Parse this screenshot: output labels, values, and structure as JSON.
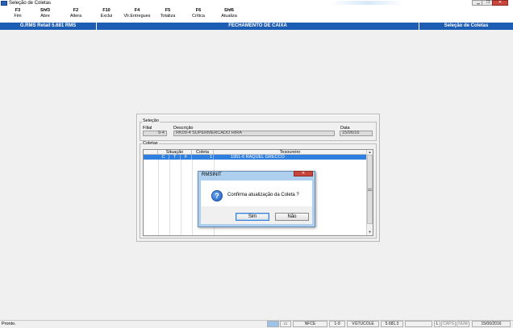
{
  "window": {
    "title": "Seleção de Coletas",
    "controls": {
      "minimize": "▁",
      "maximize": "❐",
      "close": "✕"
    }
  },
  "toolbar": [
    {
      "key": "F3",
      "label": "Fim"
    },
    {
      "key": "Shf3",
      "label": "Abre"
    },
    {
      "key": "F2",
      "label": "Altera"
    },
    {
      "key": "F10",
      "label": "Exclui"
    },
    {
      "key": "F4",
      "label": "Vlr.Entregues"
    },
    {
      "key": "F5",
      "label": "Totaliza"
    },
    {
      "key": "F6",
      "label": "Crítica"
    },
    {
      "key": "Shf6",
      "label": "Atualiza"
    }
  ],
  "header": {
    "system": "G.RMS Retail 5.681 RMS",
    "title": "FECHAMENTO DE CAIXA",
    "screen": "Seleção de Coletas",
    "color": "#1d5db3"
  },
  "selecao": {
    "group_label": "Seleção",
    "filial_label": "Filial",
    "filial_value": "9-4",
    "descricao_label": "Descrição",
    "descricao_value": "RK09-4 SUPERMERCADO HIRA",
    "data_label": "Data",
    "data_value": "15/06/16"
  },
  "coletas": {
    "group_label": "Coletas",
    "columns": [
      "Situação",
      "Coleta",
      "Tesoureiro"
    ],
    "rows": [
      {
        "sit1": "C",
        "sit2": "T",
        "sit3": "F",
        "coleta": "1",
        "tesoureiro": "1951-6 RAQUEL GRECCO"
      }
    ]
  },
  "dialog": {
    "title": "RMSINIT",
    "icon": "question-icon",
    "message": "Confirma atualização da Coleta ?",
    "yes": "Sim",
    "no": "Não"
  },
  "statusbar": {
    "text": "Pronto.",
    "items": [
      "NFCE",
      "1-9",
      "VGTUCOLE",
      "5.681.3",
      "L",
      "CAPS",
      "NUM",
      "15/06/2016"
    ]
  }
}
